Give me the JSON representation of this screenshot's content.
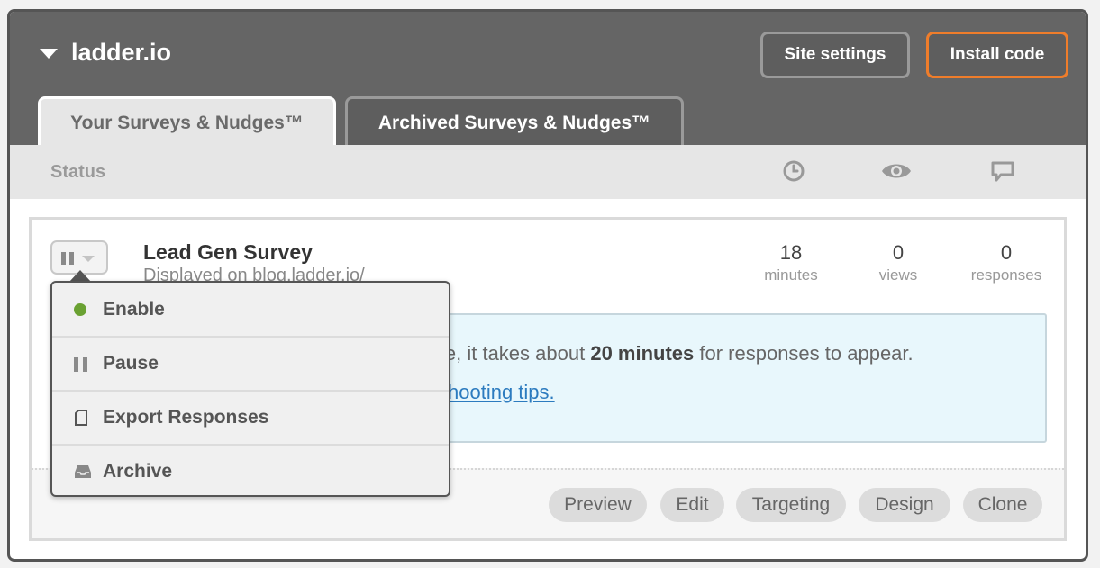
{
  "header": {
    "site_name": "ladder.io",
    "site_settings_label": "Site settings",
    "install_code_label": "Install code",
    "accent_color": "#ef7d2b"
  },
  "tabs": [
    {
      "label": "Your Surveys & Nudges™",
      "active": true
    },
    {
      "label": "Archived Surveys & Nudges™",
      "active": false
    }
  ],
  "status_bar": {
    "label": "Status",
    "column_icons": [
      "clock-icon",
      "eye-icon",
      "speech-bubble-icon"
    ]
  },
  "survey": {
    "title": "Lead Gen Survey",
    "subtitle": "Displayed on blog.ladder.io/",
    "stats": [
      {
        "value": "18",
        "label": "minutes"
      },
      {
        "value": "0",
        "label": "views"
      },
      {
        "value": "0",
        "label": "responses"
      }
    ],
    "info": {
      "prefix": "le, it takes about ",
      "bold": "20 minutes",
      "suffix": " for responses to appear.",
      "link": "hooting tips."
    },
    "actions": [
      "Preview",
      "Edit",
      "Targeting",
      "Design",
      "Clone"
    ]
  },
  "status_menu": {
    "items": [
      {
        "label": "Enable",
        "icon": "green-dot-icon"
      },
      {
        "label": "Pause",
        "icon": "pause-icon"
      },
      {
        "label": "Export Responses",
        "icon": "document-icon"
      },
      {
        "label": "Archive",
        "icon": "inbox-icon"
      }
    ],
    "enable_color": "#6aa132"
  }
}
